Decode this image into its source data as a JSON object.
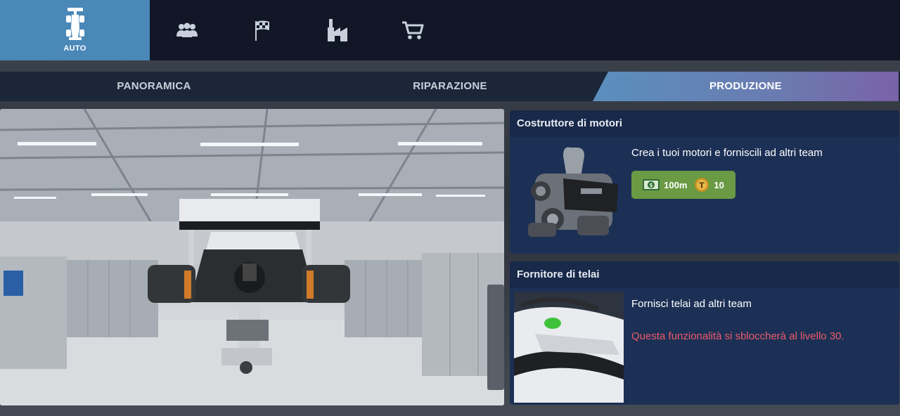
{
  "nav": {
    "tabs": [
      {
        "label": "AUTO",
        "icon": "car-icon",
        "active": true
      },
      {
        "label": "",
        "icon": "team-icon",
        "active": false
      },
      {
        "label": "",
        "icon": "race-flag-icon",
        "active": false
      },
      {
        "label": "",
        "icon": "factory-icon",
        "active": false
      },
      {
        "label": "",
        "icon": "shop-cart-icon",
        "active": false
      }
    ]
  },
  "subtabs": [
    {
      "label": "PANORAMICA",
      "active": false
    },
    {
      "label": "RIPARAZIONE",
      "active": false
    },
    {
      "label": "PRODUZIONE",
      "active": true
    }
  ],
  "cards": {
    "engine": {
      "title": "Costruttore di motori",
      "description": "Crea i tuoi motori e forniscili ad altri team",
      "cost_money": "100m",
      "cost_tokens": "10"
    },
    "chassis": {
      "title": "Fornitore di telai",
      "description": "Fornisci telai ad altri team",
      "locked_message": "Questa funzionalità si sbloccherà al livello 30."
    }
  },
  "colors": {
    "active_nav": "#4a88b8",
    "card_bg": "#1c3055",
    "cost_button": "#6a9a44",
    "warning_text": "#ee5a6a"
  }
}
